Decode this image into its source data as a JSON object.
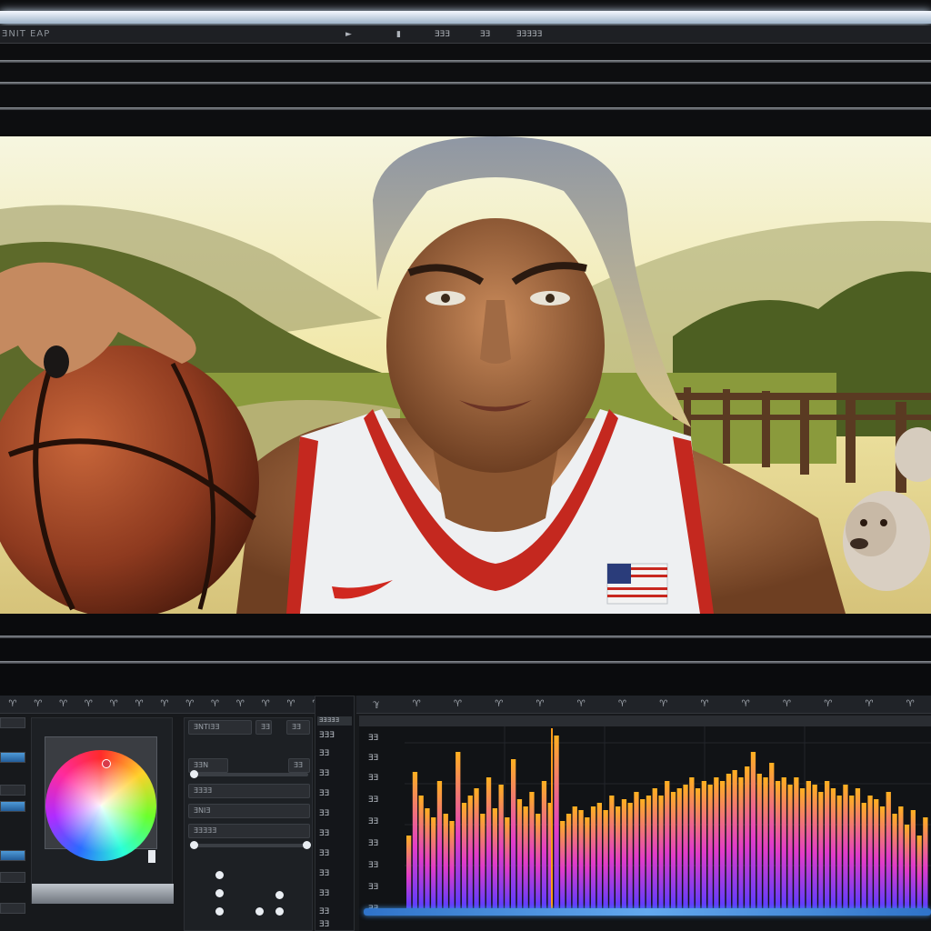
{
  "menubar": {
    "app_label": "ƎNIT EAP",
    "controls": [
      "►",
      "▮",
      "ƎƎƎ",
      "ƎƎ",
      "ƎƎƎƎƎ"
    ]
  },
  "left_tabs": [
    "♈",
    "♈",
    "♈",
    "♈",
    "♈",
    "♈",
    "♈",
    "♈",
    "♈",
    "♈",
    "♈",
    "♈",
    "♈",
    "ℽ"
  ],
  "color_panel": {
    "fields": [
      "ƎNTIƎƎ",
      "ƎƎ",
      "ƎƎ",
      "ƎƎN",
      "ƎƎ",
      "ƎƎƎƎ",
      "ƎNIƎ",
      "ƎƎƎƎƎ"
    ]
  },
  "ruler": {
    "header": "ƎƎƎƎƎ",
    "labels": [
      "ƎƎƎ",
      "ƎƎ",
      "ƎƎ",
      "ƎƎ",
      "ƎƎ",
      "ƎƎ",
      "ƎƎ",
      "ƎƎ",
      "ƎƎ",
      "ƎƎ",
      "ƎƎ"
    ],
    "histo_labels": [
      "ƎƎ",
      "ƎƎ",
      "ƎƎ",
      "ƎƎ",
      "ƎƎ",
      "ƎƎ",
      "ƎƎ",
      "ƎƎ",
      "ƎƎ"
    ]
  },
  "right_tabs": [
    "ℽ",
    "♈",
    "♈",
    "♈",
    "♈",
    "♈",
    "♈",
    "♈",
    "♈",
    "♈",
    "♈",
    "♈",
    "♈",
    "♈"
  ],
  "histogram": {
    "levels": [
      0.4,
      0.75,
      0.62,
      0.55,
      0.5,
      0.7,
      0.52,
      0.48,
      0.86,
      0.58,
      0.62,
      0.66,
      0.52,
      0.72,
      0.55,
      0.68,
      0.5,
      0.82,
      0.6,
      0.56,
      0.64,
      0.52,
      0.7,
      0.58,
      0.95,
      0.48,
      0.52,
      0.56,
      0.54,
      0.5,
      0.56,
      0.58,
      0.54,
      0.62,
      0.56,
      0.6,
      0.58,
      0.64,
      0.6,
      0.62,
      0.66,
      0.62,
      0.7,
      0.64,
      0.66,
      0.68,
      0.72,
      0.66,
      0.7,
      0.68,
      0.72,
      0.7,
      0.74,
      0.76,
      0.72,
      0.78,
      0.86,
      0.74,
      0.72,
      0.8,
      0.7,
      0.72,
      0.68,
      0.72,
      0.66,
      0.7,
      0.68,
      0.64,
      0.7,
      0.66,
      0.62,
      0.68,
      0.62,
      0.66,
      0.58,
      0.62,
      0.6,
      0.56,
      0.64,
      0.52,
      0.56,
      0.46,
      0.54,
      0.4,
      0.5
    ]
  },
  "colors": {
    "accent_blue": "#3f8fe0",
    "histo_low": "#7a3cff",
    "histo_mid": "#ff3c9e",
    "histo_high": "#ffb020"
  }
}
